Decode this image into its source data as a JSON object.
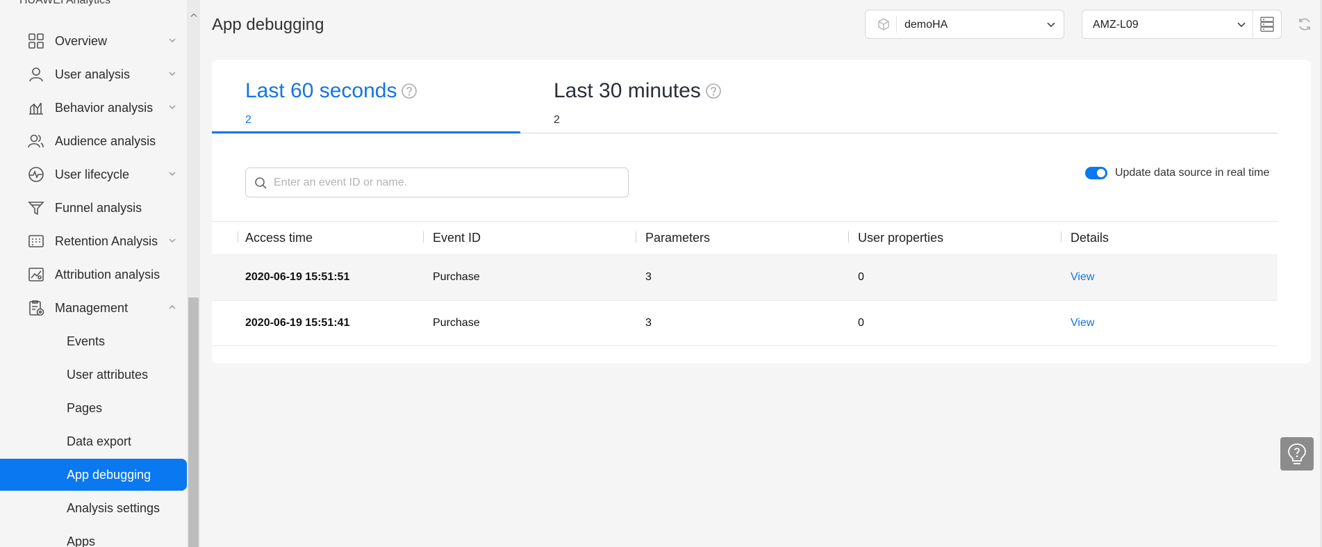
{
  "sidebar": {
    "brand": "HUAWEI Analytics",
    "items": [
      {
        "label": "Overview",
        "icon": "grid-icon",
        "expandable": true,
        "expanded": false
      },
      {
        "label": "User analysis",
        "icon": "user-icon",
        "expandable": true,
        "expanded": false
      },
      {
        "label": "Behavior analysis",
        "icon": "bar-chart-icon",
        "expandable": true,
        "expanded": false
      },
      {
        "label": "Audience analysis",
        "icon": "users-icon",
        "expandable": false
      },
      {
        "label": "User lifecycle",
        "icon": "pulse-icon",
        "expandable": true,
        "expanded": false
      },
      {
        "label": "Funnel analysis",
        "icon": "funnel-icon",
        "expandable": false
      },
      {
        "label": "Retention Analysis",
        "icon": "calendar-grid-icon",
        "expandable": true,
        "expanded": false
      },
      {
        "label": "Attribution analysis",
        "icon": "trend-image-icon",
        "expandable": false
      },
      {
        "label": "Management",
        "icon": "clipboard-settings-icon",
        "expandable": true,
        "expanded": true
      }
    ],
    "subitems": [
      {
        "label": "Events"
      },
      {
        "label": "User attributes"
      },
      {
        "label": "Pages"
      },
      {
        "label": "Data export"
      },
      {
        "label": "App debugging",
        "active": true
      },
      {
        "label": "Analysis settings"
      },
      {
        "label": "Apps"
      }
    ]
  },
  "header": {
    "title": "App debugging",
    "app_select": {
      "value": "demoHA",
      "icon": "cube-icon"
    },
    "device_select": {
      "value": "AMZ-L09",
      "icon": "list-icon"
    },
    "refresh_icon": "refresh-icon"
  },
  "tabs": [
    {
      "label": "Last 60 seconds",
      "count": "2",
      "active": true
    },
    {
      "label": "Last 30 minutes",
      "count": "2",
      "active": false
    }
  ],
  "search": {
    "placeholder": "Enter an event ID or name.",
    "value": ""
  },
  "realtime_toggle": {
    "label": "Update data source in real time",
    "on": true
  },
  "table": {
    "columns": [
      "Access time",
      "Event ID",
      "Parameters",
      "User properties",
      "Details"
    ],
    "rows": [
      {
        "time": "2020-06-19 15:51:51",
        "event_id": "Purchase",
        "parameters": "3",
        "user_properties": "0",
        "details": "View"
      },
      {
        "time": "2020-06-19 15:51:41",
        "event_id": "Purchase",
        "parameters": "3",
        "user_properties": "0",
        "details": "View"
      }
    ]
  },
  "colors": {
    "accent": "#0a78f0",
    "link": "#1473e6",
    "background": "#f5f5f5"
  },
  "help_icon": "lightbulb-question-icon"
}
